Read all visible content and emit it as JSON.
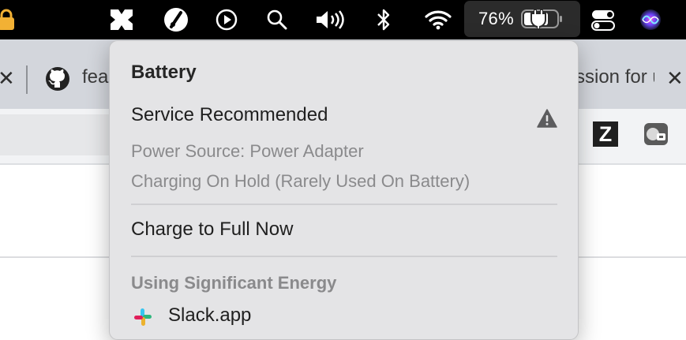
{
  "menubar": {
    "battery_percent": "76%",
    "icons": [
      "app-menu-icon",
      "speedometer-icon",
      "play-icon",
      "search-icon",
      "volume-icon",
      "bluetooth-icon",
      "wifi-icon",
      "battery-charging-icon",
      "control-center-icon",
      "siri-icon"
    ]
  },
  "browser": {
    "tabs": [
      {
        "label": "fea"
      },
      {
        "label": "ssion for u"
      }
    ]
  },
  "battery_menu": {
    "title": "Battery",
    "status": "Service Recommended",
    "power_source": "Power Source: Power Adapter",
    "charging_status": "Charging On Hold (Rarely Used On Battery)",
    "action": "Charge to Full Now",
    "section_title": "Using Significant Energy",
    "apps": [
      {
        "name": "Slack.app"
      }
    ]
  },
  "colors": {
    "menubar_bg": "#000000",
    "menu_bg": "#e4e4e6",
    "secondary_text": "#8a8a8c"
  }
}
